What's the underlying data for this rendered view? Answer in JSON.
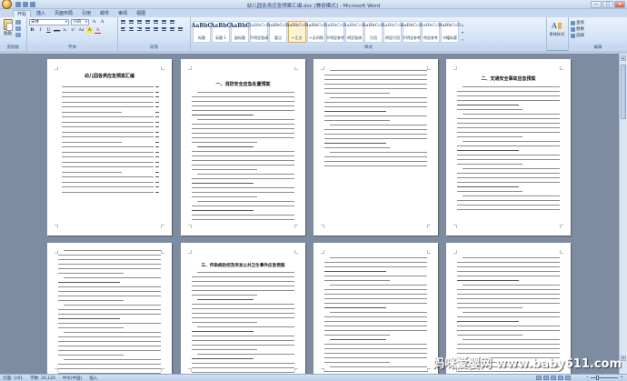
{
  "window": {
    "title": "幼儿园各类应急预案汇编.doc [兼容模式] - Microsoft Word",
    "controls": [
      "—",
      "□",
      "✕"
    ]
  },
  "tabs": [
    "开始",
    "插入",
    "页面布局",
    "引用",
    "邮件",
    "审阅",
    "视图"
  ],
  "ribbon": {
    "clipboard": {
      "paste_label": "粘贴",
      "group_label": "剪贴板"
    },
    "font": {
      "font_name": "宋体",
      "font_size": "小四",
      "buttons": [
        "B",
        "I",
        "U",
        "abe",
        "x₂",
        "x²",
        "Aa",
        "A",
        "A"
      ],
      "group_label": "字体"
    },
    "paragraph": {
      "group_label": "段落"
    },
    "styles": {
      "tiles": [
        {
          "sample": "AaBbC",
          "name": "标题",
          "kind": "big"
        },
        {
          "sample": "AaBbC",
          "name": "标题 1",
          "kind": "big"
        },
        {
          "sample": "AaBbC",
          "name": "副标题",
          "kind": "big"
        },
        {
          "sample": "AaBbCcD",
          "name": "不明显强调",
          "kind": "blue"
        },
        {
          "sample": "AaBbCcD",
          "name": "要点",
          "kind": "normal"
        },
        {
          "sample": "AaBbCcD",
          "name": "↵正文",
          "kind": "selected"
        },
        {
          "sample": "AaBbCcD",
          "name": "↵无间隔",
          "kind": "normal"
        },
        {
          "sample": "AaBbCcD",
          "name": "不明显参考",
          "kind": "blue"
        },
        {
          "sample": "AaBbCcD",
          "name": "明显强调",
          "kind": "blue"
        },
        {
          "sample": "AaBbCcD",
          "name": "引用",
          "kind": "normal"
        },
        {
          "sample": "AaBbCcD",
          "name": "明显引用",
          "kind": "blue"
        },
        {
          "sample": "AaBbCcD",
          "name": "不明显参考",
          "kind": "normal"
        },
        {
          "sample": "AaBbCcD",
          "name": "明显参考",
          "kind": "blue"
        },
        {
          "sample": "AaBbCcD",
          "name": "书籍标题",
          "kind": "normal"
        }
      ],
      "group_label": "样式"
    },
    "change_styles": {
      "label": "更改样式"
    },
    "editing": {
      "items": [
        "查找",
        "替换",
        "选择"
      ],
      "group_label": "编辑"
    }
  },
  "pages": {
    "p1_title": "幼儿园各类应急预案汇编",
    "p2_title": "一、消防安全应急处置预案",
    "p4_title": "二、交通安全事故应急预案",
    "p6_title": "三、传染病防控及突发公共卫生事件应急预案"
  },
  "status": {
    "page": "页面: 1/61",
    "words": "字数: 26,120",
    "language": "中文(中国)",
    "mode": "插入"
  },
  "watermark": "妈咪爱婴网 www.baby611.com"
}
